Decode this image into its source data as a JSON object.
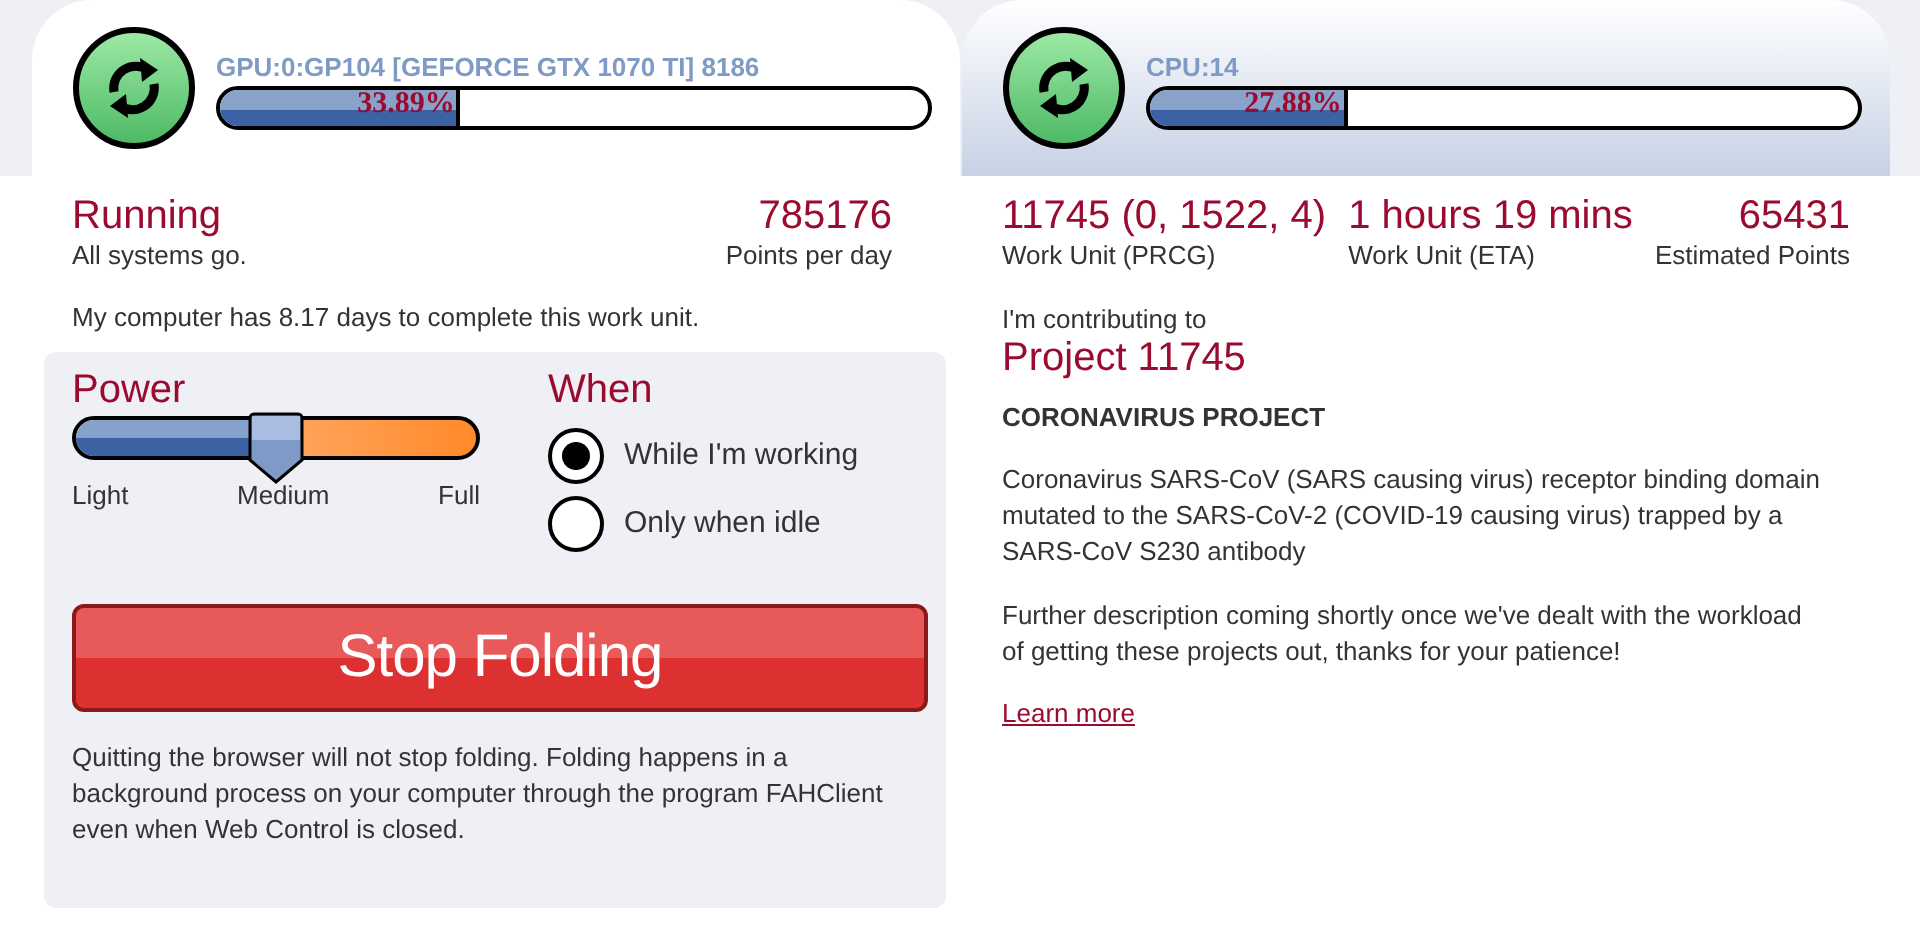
{
  "slots": [
    {
      "name": "GPU:0:GP104 [GEFORCE GTX 1070 TI] 8186",
      "progress": "33.89%",
      "level": 0.3389,
      "selected": false
    },
    {
      "name": "CPU:14",
      "progress": "27.88%",
      "level": 0.2788,
      "selected": true
    }
  ],
  "status": {
    "state": "Running",
    "message": "All systems go.",
    "points": "785176",
    "points_label": "Points per day"
  },
  "notice": "My computer has 8.17 days to complete this work unit.",
  "power": {
    "title": "Power",
    "level": 0.5,
    "labels": [
      "Light",
      "Medium",
      "Full"
    ]
  },
  "when": {
    "title": "When",
    "options": [
      {
        "label": "While I'm working",
        "selected": true
      },
      {
        "label": "Only when idle",
        "selected": false
      }
    ]
  },
  "stop_button": "Stop Folding",
  "footnote": "Quitting the browser will not stop folding. Folding happens in a background process on your computer through the program FAHClient even when Web Control is closed.",
  "work_unit": {
    "stats": [
      {
        "value": "11745 (0, 1522, 4)",
        "label": "Work Unit (PRCG)"
      },
      {
        "value": "1 hours 19 mins",
        "label": "Work Unit (ETA)"
      },
      {
        "value": "65431",
        "label": "Estimated Points"
      }
    ]
  },
  "project": {
    "intro": "I'm contributing to",
    "name": "Project 11745",
    "title": "CORONAVIRUS PROJECT",
    "paragraphs": [
      "Coronavirus SARS-CoV (SARS causing virus) receptor binding domain mutated to the SARS-CoV-2 (COVID-19 causing virus) trapped by a SARS-CoV S230 antibody",
      "Further description coming shortly once we've dealt with the workload of getting these projects out, thanks for your patience!"
    ],
    "link": "Learn more"
  }
}
